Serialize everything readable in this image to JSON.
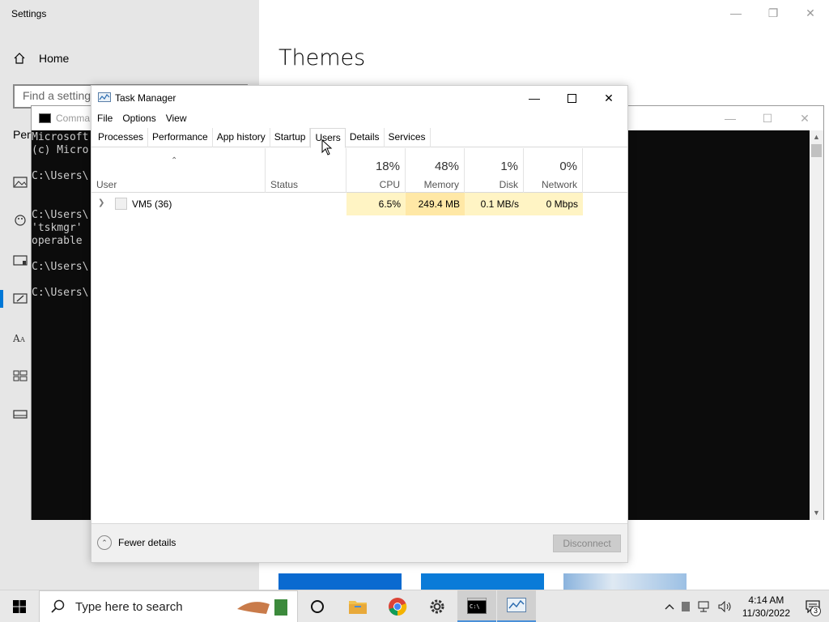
{
  "settings": {
    "title": "Settings",
    "home_label": "Home",
    "search_placeholder": "Find a setting",
    "section_label": "Per",
    "heading": "Themes",
    "window_controls": [
      "minimize-icon",
      "restore-icon",
      "close-icon"
    ]
  },
  "cmd": {
    "title": "Comma",
    "lines": [
      "Microsoft",
      "(c) Micro",
      "",
      "C:\\Users\\",
      "",
      "",
      "C:\\Users\\",
      "'tskmgr'",
      "operable",
      "",
      "C:\\Users\\",
      "",
      "C:\\Users\\"
    ]
  },
  "task_manager": {
    "title": "Task Manager",
    "menu": [
      "File",
      "Options",
      "View"
    ],
    "tabs": [
      "Processes",
      "Performance",
      "App history",
      "Startup",
      "Users",
      "Details",
      "Services"
    ],
    "active_tab": "Users",
    "columns": {
      "user": {
        "label": "User"
      },
      "status": {
        "label": "Status"
      },
      "cpu": {
        "pct": "18%",
        "label": "CPU"
      },
      "memory": {
        "pct": "48%",
        "label": "Memory"
      },
      "disk": {
        "pct": "1%",
        "label": "Disk"
      },
      "network": {
        "pct": "0%",
        "label": "Network"
      }
    },
    "rows": [
      {
        "user": "VM5 (36)",
        "status": "",
        "cpu": "6.5%",
        "memory": "249.4 MB",
        "disk": "0.1 MB/s",
        "network": "0 Mbps"
      }
    ],
    "footer": {
      "fewer_details": "Fewer details",
      "disconnect": "Disconnect"
    }
  },
  "taskbar": {
    "search_placeholder": "Type here to search",
    "pinned": [
      "cortana-icon",
      "file-explorer-icon",
      "chrome-icon",
      "settings-icon",
      "cmd-icon",
      "task-manager-icon"
    ],
    "clock_time": "4:14 AM",
    "clock_date": "11/30/2022",
    "notification_count": "3"
  },
  "colors": {
    "accent": "#0078d7",
    "heat_light": "#fff4c4",
    "heat_medium": "#ffe8a6",
    "console_bg": "#0c0c0c"
  }
}
